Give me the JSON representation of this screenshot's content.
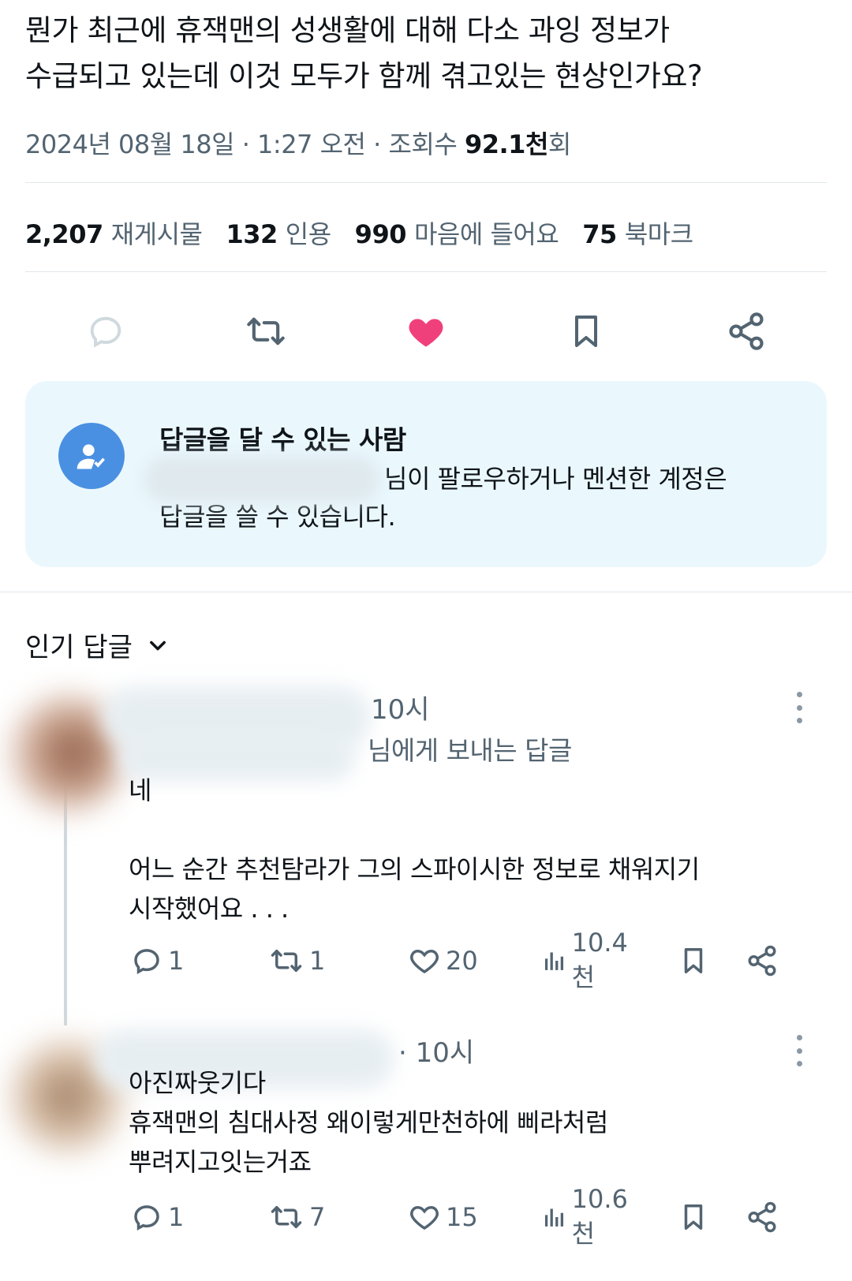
{
  "tweet": {
    "text": "뭔가  최근에  휴잭맨의 성생활에  대해 다소   과잉  정보가\n수급되고 있는데 이것  모두가 함께 겪고있는 현상인가요?",
    "datetime": "2024년 08월 18일 · 1:27 오전 · 조회수 ",
    "views_value": "92.1천",
    "views_suffix": "회"
  },
  "stats": [
    {
      "num": "2,207",
      "label": "재게시물"
    },
    {
      "num": "132",
      "label": "인용"
    },
    {
      "num": "990",
      "label": "마음에 들어요"
    },
    {
      "num": "75",
      "label": "북마크"
    }
  ],
  "actions": {
    "reply_icon": "reply-icon",
    "retweet_icon": "retweet-icon",
    "like_icon": "heart-filled-icon",
    "bookmark_icon": "bookmark-icon",
    "share_icon": "share-icon",
    "like_color": "#f0407c"
  },
  "reply_settings": {
    "title": "답글을 달 수 있는 사람",
    "line1": "님이 팔로우하거나 멘션한 계정은",
    "line2": "답글을 쓸 수 있습니다."
  },
  "sort": {
    "label": "인기 답글"
  },
  "replies": [
    {
      "time": "10시",
      "replying_to": "님에게 보내는 답글",
      "body": "네\n\n어느 순간 추천탐라가 그의 스파이시한 정보로 채워지기\n시작했어요 . . .",
      "reply_count": "1",
      "retweet_count": "1",
      "like_count": "20",
      "view_count": "10.4천"
    },
    {
      "time": "· 10시",
      "body": "아진짜웃기다\n휴잭맨의 침대사정  왜이렇게만천하에 삐라처럼\n뿌려지고잇는거죠",
      "reply_count": "1",
      "retweet_count": "7",
      "like_count": "15",
      "view_count": "10.6천"
    }
  ]
}
